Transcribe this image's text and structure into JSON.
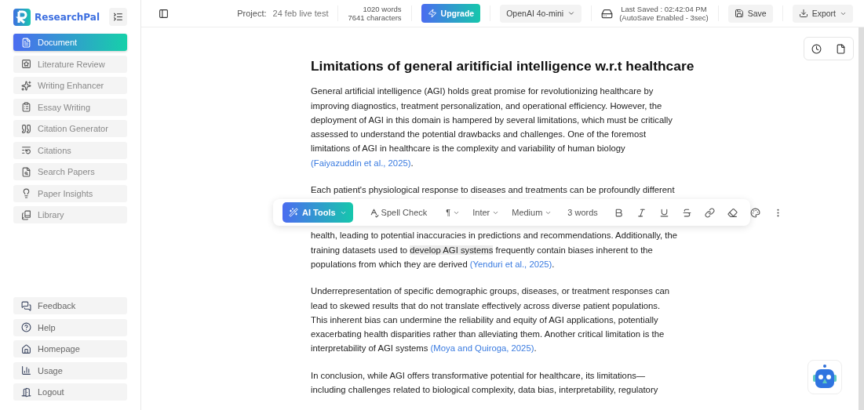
{
  "brand": {
    "name": "ResearchPal"
  },
  "sidebar": {
    "items": [
      {
        "label": "Document",
        "selected": true
      },
      {
        "label": "Literature Review",
        "selected": false
      },
      {
        "label": "Writing Enhancer",
        "selected": false
      },
      {
        "label": "Essay Writing",
        "selected": false
      },
      {
        "label": "Citation Generator",
        "selected": false
      },
      {
        "label": "Citations",
        "selected": false
      },
      {
        "label": "Search Papers",
        "selected": false
      },
      {
        "label": "Paper Insights",
        "selected": false
      },
      {
        "label": "Library",
        "selected": false
      }
    ],
    "bottom_items": [
      {
        "label": "Feedback"
      },
      {
        "label": "Help"
      },
      {
        "label": "Homepage"
      },
      {
        "label": "Usage"
      },
      {
        "label": "Logout"
      }
    ]
  },
  "topbar": {
    "project_label": "Project:",
    "project_name": "24 feb live test",
    "words": "1020 words",
    "characters": "7641 characters",
    "upgrade": "Upgrade",
    "model": "OpenAI 4o-mini",
    "last_saved": "Last Saved : 02:42:04 PM",
    "autosave": "(AutoSave Enabled - 3sec)",
    "save": "Save",
    "export": "Export"
  },
  "document": {
    "title": "Limitations of general aritificial intelligence w.r.t healthcare",
    "paragraphs": [
      {
        "segments": [
          {
            "kind": "plain",
            "text": "General artificial intelligence (AGI) holds great promise for revolutionizing healthcare by improving diagnostics, treatment personalization, and operational efficiency. However, the deployment of AGI in this domain is hampered by several limitations, which must be critically assessed to understand the potential drawbacks and challenges. One of the foremost limitations of AGI in healthcare is the complexity and variability of human biology "
          },
          {
            "kind": "citation",
            "text": "(Faiyazuddin et al., 2025)"
          },
          {
            "kind": "plain",
            "text": "."
          }
        ]
      },
      {
        "segments": [
          {
            "kind": "plain",
            "text": "Each patient's physiological response to diseases and treatments can be profoundly different"
          }
        ]
      },
      {
        "segments": [
          {
            "kind": "plain",
            "text": "health, leading to potential inaccuracies in predictions and recommendations. Additionally, the training datasets used to "
          },
          {
            "kind": "highlight",
            "text": "develop AGI systems"
          },
          {
            "kind": "plain",
            "text": " frequently contain biases inherent to the populations from which they are derived "
          },
          {
            "kind": "citation",
            "text": "(Yenduri et al., 2025)"
          },
          {
            "kind": "plain",
            "text": "."
          }
        ]
      },
      {
        "segments": [
          {
            "kind": "plain",
            "text": "Underrepresentation of specific demographic groups, diseases, or treatment responses can lead to skewed results that do not translate effectively across diverse patient populations. This inherent bias can undermine the reliability and equity of AGI applications, potentially exacerbating health disparities rather than alleviating them. Another critical limitation is the interpretability of AGI systems "
          },
          {
            "kind": "citation",
            "text": "(Moya and Quiroga, 2025)"
          },
          {
            "kind": "plain",
            "text": "."
          }
        ]
      },
      {
        "segments": [
          {
            "kind": "plain",
            "text": "In conclusion, while AGI offers transformative potential for healthcare, its limitations— including challenges related to biological complexity, data bias, interpretability, regulatory"
          }
        ]
      }
    ]
  },
  "toolbar": {
    "ai_tools": "AI Tools",
    "spell_check": "Spell Check",
    "paragraph": "¶",
    "font": "Inter",
    "weight": "Medium",
    "selection": "3 words"
  }
}
